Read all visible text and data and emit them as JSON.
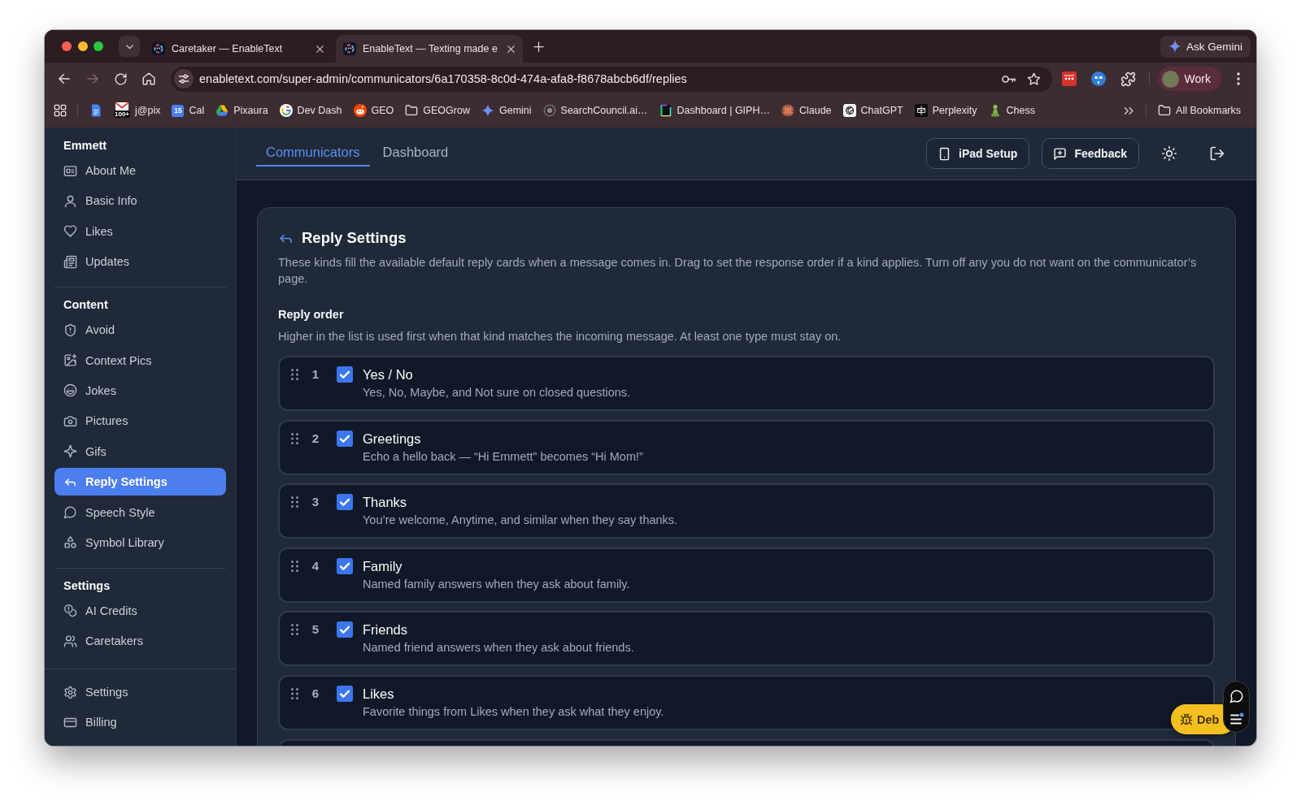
{
  "browser": {
    "tabs": [
      {
        "title": "Caretaker — EnableText",
        "selected": false
      },
      {
        "title": "EnableText — Texting made e",
        "selected": true
      }
    ],
    "ask_gemini": "Ask Gemini",
    "url": "enabletext.com/super-admin/communicators/6a170358-8c0d-474a-afa8-f8678abcb6df/replies",
    "profile": "Work",
    "bookmarks": [
      {
        "kind": "link"
      },
      {
        "kind": "link",
        "label": "j@pix",
        "badge": "100+"
      },
      {
        "kind": "link",
        "label": "Cal",
        "badge": "15"
      },
      {
        "kind": "link",
        "label": "Pixaura"
      },
      {
        "kind": "link",
        "label": "Dev Dash"
      },
      {
        "kind": "link",
        "label": "GEO"
      },
      {
        "kind": "folder",
        "label": "GEOGrow"
      },
      {
        "kind": "link",
        "label": "Gemini"
      },
      {
        "kind": "link",
        "label": "SearchCouncil.ai…"
      },
      {
        "kind": "link",
        "label": "Dashboard | GIPH…"
      },
      {
        "kind": "link",
        "label": "Claude"
      },
      {
        "kind": "link",
        "label": "ChatGPT"
      },
      {
        "kind": "link",
        "label": "Perplexity"
      },
      {
        "kind": "link",
        "label": "Chess"
      }
    ],
    "all_bookmarks": "All Bookmarks"
  },
  "sidebar": {
    "sections": [
      {
        "title": "Emmett",
        "items": [
          {
            "label": "About Me",
            "selected": false
          },
          {
            "label": "Basic Info",
            "selected": false
          },
          {
            "label": "Likes",
            "selected": false
          },
          {
            "label": "Updates",
            "selected": false
          }
        ]
      },
      {
        "title": "Content",
        "items": [
          {
            "label": "Avoid",
            "selected": false
          },
          {
            "label": "Context Pics",
            "selected": false
          },
          {
            "label": "Jokes",
            "selected": false
          },
          {
            "label": "Pictures",
            "selected": false
          },
          {
            "label": "Gifs",
            "selected": false
          },
          {
            "label": "Reply Settings",
            "selected": true
          },
          {
            "label": "Speech Style",
            "selected": false
          },
          {
            "label": "Symbol Library",
            "selected": false
          }
        ]
      },
      {
        "title": "Settings",
        "items": [
          {
            "label": "AI Credits",
            "selected": false
          },
          {
            "label": "Caretakers",
            "selected": false
          }
        ]
      }
    ],
    "footer": [
      {
        "label": "Settings",
        "selected": false
      },
      {
        "label": "Billing",
        "selected": false
      }
    ]
  },
  "header": {
    "tabs": [
      {
        "label": "Communicators",
        "selected": true
      },
      {
        "label": "Dashboard",
        "selected": false
      }
    ],
    "buttons": [
      {
        "label": "iPad Setup"
      },
      {
        "label": "Feedback"
      }
    ]
  },
  "card": {
    "title": "Reply Settings",
    "description": "These kinds fill the available default reply cards when a message comes in. Drag to set the response order if a kind applies. Turn off any you do not want on the communicator’s page.",
    "section_title": "Reply order",
    "hint": "Higher in the list is used first when that kind matches the incoming message. At least one type must stay on.",
    "rows": [
      {
        "number": "1",
        "title": "Yes / No",
        "description": "Yes, No, Maybe, and Not sure on closed questions.",
        "checked": true
      },
      {
        "number": "2",
        "title": "Greetings",
        "description": "Echo a hello back — “Hi Emmett” becomes “Hi Mom!”",
        "checked": true
      },
      {
        "number": "3",
        "title": "Thanks",
        "description": "You’re welcome, Anytime, and similar when they say thanks.",
        "checked": true
      },
      {
        "number": "4",
        "title": "Family",
        "description": "Named family answers when they ask about family.",
        "checked": true
      },
      {
        "number": "5",
        "title": "Friends",
        "description": "Named friend answers when they ask about friends.",
        "checked": true
      },
      {
        "number": "6",
        "title": "Likes",
        "description": "Favorite things from Likes when they ask what they enjoy.",
        "checked": true
      }
    ]
  },
  "debug_button": {
    "label": "Deb"
  }
}
